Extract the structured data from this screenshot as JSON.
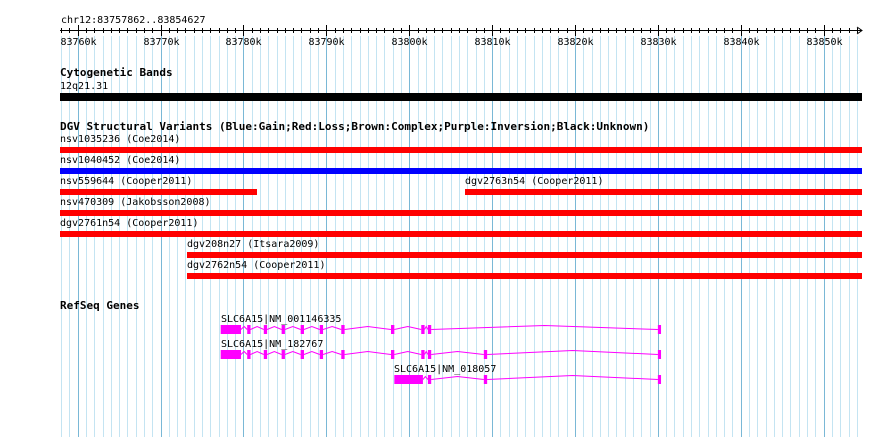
{
  "ruler": {
    "location": "chr12:83757862..83854627",
    "start": 83757862,
    "end": 83854627,
    "ticks": [
      {
        "pos": 83760000,
        "label": "83760k"
      },
      {
        "pos": 83770000,
        "label": "83770k"
      },
      {
        "pos": 83780000,
        "label": "83780k"
      },
      {
        "pos": 83790000,
        "label": "83790k"
      },
      {
        "pos": 83800000,
        "label": "83800k"
      },
      {
        "pos": 83810000,
        "label": "83810k"
      },
      {
        "pos": 83820000,
        "label": "83820k"
      },
      {
        "pos": 83830000,
        "label": "83830k"
      },
      {
        "pos": 83840000,
        "label": "83840k"
      },
      {
        "pos": 83850000,
        "label": "83850k"
      }
    ]
  },
  "tracks": {
    "cytoband": {
      "title": "Cytogenetic Bands",
      "band": {
        "label": "12q21.31",
        "color": "#000000"
      }
    },
    "dgv": {
      "title": "DGV Structural Variants (Blue:Gain;Red:Loss;Brown:Complex;Purple:Inversion;Black:Unknown)",
      "colors": {
        "gain": "#0000ff",
        "loss": "#ff0000"
      },
      "variants": [
        {
          "label": "nsv1035236 (Coe2014)",
          "type": "loss",
          "start": 83757862,
          "end": 83854627
        },
        {
          "label": "nsv1040452 (Coe2014)",
          "type": "gain",
          "start": 83757862,
          "end": 83854627
        },
        {
          "label": "nsv559644 (Cooper2011)",
          "type": "loss",
          "start": 83757862,
          "end": 83781640
        },
        {
          "label": "dgv2763n54 (Cooper2011)",
          "type": "loss",
          "start": 83806700,
          "end": 83854627
        },
        {
          "label": "nsv470309 (Jakobsson2008)",
          "type": "loss",
          "start": 83757862,
          "end": 83854627
        },
        {
          "label": "dgv2761n54 (Cooper2011)",
          "type": "loss",
          "start": 83757862,
          "end": 83854627
        },
        {
          "label": "dgv208n27 (Itsara2009)",
          "type": "loss",
          "start": 83773200,
          "end": 83854627
        },
        {
          "label": "dgv2762n54 (Cooper2011)",
          "type": "loss",
          "start": 83773200,
          "end": 83854627
        }
      ]
    },
    "refseq": {
      "title": "RefSeq Genes",
      "color": "#ff00ff",
      "genes": [
        {
          "label": "SLC6A15|NM_001146335",
          "start": 83777250,
          "end": 83830380,
          "exons": [
            [
              83777250,
              83779700
            ],
            [
              83780450,
              83780850
            ],
            [
              83782450,
              83782850
            ],
            [
              83784600,
              83785000
            ],
            [
              83786900,
              83787300
            ],
            [
              83789200,
              83789600
            ],
            [
              83791800,
              83792200
            ],
            [
              83797800,
              83798200
            ],
            [
              83801450,
              83801850
            ],
            [
              83802250,
              83802650
            ],
            [
              83830000,
              83830380
            ]
          ]
        },
        {
          "label": "SLC6A15|NM_182767",
          "start": 83777250,
          "end": 83830380,
          "exons": [
            [
              83777250,
              83779700
            ],
            [
              83780450,
              83780850
            ],
            [
              83782450,
              83782850
            ],
            [
              83784600,
              83785000
            ],
            [
              83786900,
              83787300
            ],
            [
              83789200,
              83789600
            ],
            [
              83791800,
              83792200
            ],
            [
              83797800,
              83798200
            ],
            [
              83801450,
              83801850
            ],
            [
              83802250,
              83802650
            ],
            [
              83809000,
              83809400
            ],
            [
              83830000,
              83830380
            ]
          ]
        },
        {
          "label": "SLC6A15|NM_018057",
          "start": 83798200,
          "end": 83830380,
          "exons": [
            [
              83798200,
              83801650
            ],
            [
              83802250,
              83802650
            ],
            [
              83809000,
              83809400
            ],
            [
              83830000,
              83830380
            ]
          ]
        }
      ]
    }
  }
}
